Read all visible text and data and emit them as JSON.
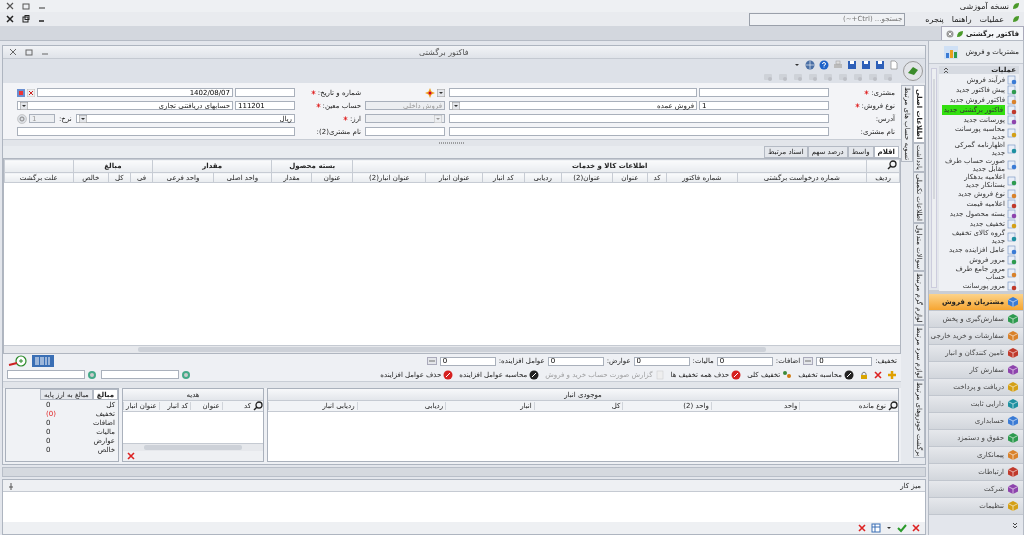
{
  "app": {
    "title": "نسخه آموزشی"
  },
  "menu": [
    "عملیات",
    "راهنما",
    "پنجره"
  ],
  "search": {
    "placeholder": "جستجو... (Ctrl+~)"
  },
  "doc_tabs": [
    {
      "label": "فاکتور برگشتی",
      "selected": true
    }
  ],
  "form_window": {
    "title": "فاکتور برگشتی"
  },
  "form": {
    "customer": {
      "label": "مشتری:",
      "required": true
    },
    "number_date": {
      "label": "شماره و تاریخ:",
      "required": true,
      "date": "1402/08/07"
    },
    "sale_type": {
      "label": "نوع فروش:",
      "required": true,
      "code": "1",
      "name": "فروش عمده",
      "subtype": "فروش داخلی",
      "subtype_disabled": true
    },
    "account": {
      "label": "حساب معین:",
      "required": true,
      "code": "111201",
      "name": "حسابهای دریافتنی تجاری"
    },
    "address": {
      "label": "آدرس:",
      "required": false
    },
    "currency": {
      "label": "ارز:",
      "required": true,
      "value": "ریال",
      "rate_label": "نرخ:",
      "rate": "1"
    },
    "customer_name": {
      "label": "نام مشتری:",
      "required": false
    },
    "customer_name_2": {
      "label": "نام مشتری(2):",
      "required": false
    }
  },
  "side_tabs": [
    {
      "label": "اطلاعات اصلی",
      "selected": true
    },
    {
      "label": "یادداشت",
      "selected": false
    },
    {
      "label": "اطلاعات تکمیلی",
      "selected": false
    },
    {
      "label": "سوالات متداول",
      "selected": false
    },
    {
      "label": "لوازم گرم مرتبط",
      "selected": false
    },
    {
      "label": "لوازم سرد مرتبط",
      "selected": false
    },
    {
      "label": "برگشت خودروهای مرتبط",
      "selected": false
    }
  ],
  "side_tabs_outer": [
    {
      "label": "تسویه حساب های مرتبط",
      "selected": false
    }
  ],
  "grid_tabs": [
    {
      "label": "اقلام",
      "selected": true
    },
    {
      "label": "واسط",
      "selected": false
    },
    {
      "label": "درصد سهم",
      "selected": false
    },
    {
      "label": "اسناد مرتبط",
      "selected": false
    }
  ],
  "table": {
    "header": [
      {
        "columns": [
          "ردیف"
        ]
      },
      {
        "label": "اطلاعات کالا و خدمات",
        "columns": [
          "شماره درخواست برگشتی",
          "شماره فاکتور",
          "کد",
          "عنوان",
          "عنوان(2)",
          "ردیابی",
          "کد انبار",
          "عنوان انبار",
          "عنوان انبار(2)"
        ]
      },
      {
        "label": "بسته محصول",
        "columns": [
          "عنوان",
          "مقدار"
        ]
      },
      {
        "label": "مقدار",
        "columns": [
          "واحد اصلی",
          "واحد فرعی"
        ]
      },
      {
        "label": "مبالغ",
        "columns": [
          "فی",
          "کل",
          "خالص"
        ]
      },
      {
        "columns": [
          "علت برگشت"
        ]
      }
    ]
  },
  "totals": [
    {
      "label": "تخفیف:",
      "value": "0",
      "has_button": true
    },
    {
      "label": "اضافات:",
      "value": "0",
      "has_button": false
    },
    {
      "label": "مالیات:",
      "value": "0",
      "has_button": false
    },
    {
      "label": "عوارض:",
      "value": "0",
      "has_button": false
    },
    {
      "label": "عوامل افزاینده:",
      "value": "0",
      "has_button": true
    }
  ],
  "actions": [
    {
      "label": "محاسبه تخفیف",
      "kind": "calc",
      "disabled": false
    },
    {
      "label": "تخفیف کلی",
      "kind": "people",
      "disabled": false
    },
    {
      "label": "حذف همه تخفیف ها",
      "kind": "remove",
      "disabled": false
    },
    {
      "label": "گزارش صورت حساب خرید و فروش",
      "kind": "report",
      "disabled": true
    },
    {
      "label": "محاسبه عوامل افزاینده",
      "kind": "calc",
      "disabled": false
    },
    {
      "label": "حذف عوامل افزاینده",
      "kind": "remove",
      "disabled": false
    }
  ],
  "stock_panel": {
    "title": "موجودی انبار",
    "columns": [
      "نوع مانده",
      "واحد",
      "واحد (2)",
      "کل",
      "انبار",
      "ردیابی",
      "ردیابی انبار"
    ]
  },
  "gift_panel": {
    "title": "هدیه",
    "columns": [
      "کد",
      "عنوان",
      "کد انبار",
      "عنوان انبار"
    ]
  },
  "summary_panel": {
    "tabs": [
      {
        "label": "مبالغ",
        "selected": true
      },
      {
        "label": "مبالغ به ارز پایه",
        "selected": false
      }
    ],
    "rows": [
      {
        "label": "کل",
        "value": "0",
        "negative": false
      },
      {
        "label": "تخفیف",
        "value": "(0)",
        "negative": true
      },
      {
        "label": "اضافات",
        "value": "0",
        "negative": false
      },
      {
        "label": "مالیات",
        "value": "0",
        "negative": false
      },
      {
        "label": "عوارض",
        "value": "0",
        "negative": false
      },
      {
        "label": "خالص",
        "value": "0",
        "negative": false
      }
    ]
  },
  "desk_panel": {
    "title": "میز کار"
  },
  "sidebar": {
    "title": "مشتریات و فروش",
    "section": "عملیات",
    "items": [
      {
        "label": "فرآیند فروش",
        "selected": false
      },
      {
        "label": "پیش فاکتور جدید",
        "selected": false
      },
      {
        "label": "فاکتور فروش جدید",
        "selected": false
      },
      {
        "label": "فاکتور برگشتی جدید",
        "selected": true
      },
      {
        "label": "پورسانت جدید",
        "selected": false
      },
      {
        "label": "محاسبه پورسانت جدید",
        "selected": false
      },
      {
        "label": "اظهارنامه گمرکی جدید",
        "selected": false
      },
      {
        "label": "صورت حساب طرف مقابل جدید",
        "selected": false
      },
      {
        "label": "اعلامیه بدهکار بستانکار جدید",
        "selected": false
      },
      {
        "label": "نوع فروش جدید",
        "selected": false
      },
      {
        "label": "اعلامیه قیمت",
        "selected": false
      },
      {
        "label": "بسته محصول جدید",
        "selected": false
      },
      {
        "label": "تخفیف جدید",
        "selected": false
      },
      {
        "label": "گروه کالای تخفیف جدید",
        "selected": false
      },
      {
        "label": "عامل افزاینده جدید",
        "selected": false
      },
      {
        "label": "مرور فروش",
        "selected": false
      },
      {
        "label": "مرور جامع طرف حساب",
        "selected": false
      },
      {
        "label": "مرور پورسانت",
        "selected": false
      }
    ],
    "modules": [
      {
        "label": "مشتریان و فروش",
        "selected": true
      },
      {
        "label": "سفارش‌گیری و پخش",
        "selected": false
      },
      {
        "label": "سفارشات و خرید خارجی",
        "selected": false
      },
      {
        "label": "تامین کنندگان و انبار",
        "selected": false
      },
      {
        "label": "سفارش کار",
        "selected": false
      },
      {
        "label": "دریافت و پرداخت",
        "selected": false
      },
      {
        "label": "دارایی ثابت",
        "selected": false
      },
      {
        "label": "حسابداری",
        "selected": false
      },
      {
        "label": "حقوق و دستمزد",
        "selected": false
      },
      {
        "label": "پیمانکاری",
        "selected": false
      },
      {
        "label": "ارتباطات",
        "selected": false
      },
      {
        "label": "شرکت",
        "selected": false
      },
      {
        "label": "تنظیمات",
        "selected": false
      }
    ]
  }
}
